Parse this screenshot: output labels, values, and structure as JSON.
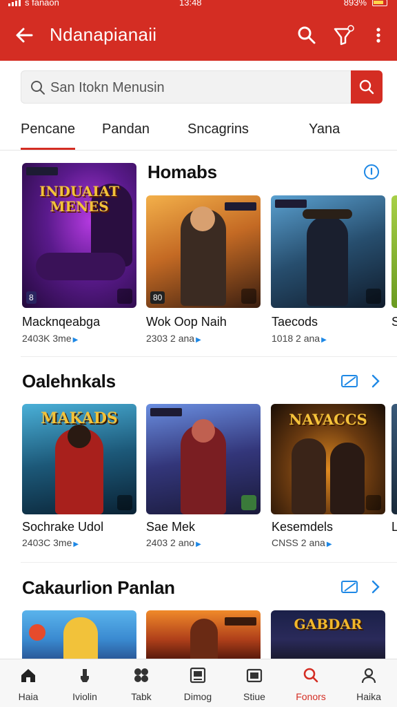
{
  "status_bar": {
    "carrier": "s fanaon",
    "time": "13:48",
    "battery": "893%"
  },
  "app_bar": {
    "title": "Ndanapianaii",
    "icons": [
      "back-arrow-icon",
      "search-icon",
      "filter-icon",
      "more-vert-icon"
    ]
  },
  "search": {
    "placeholder": "San Itokn Menusin"
  },
  "tabs": [
    {
      "label": "Pencane",
      "active": true
    },
    {
      "label": "Pandan"
    },
    {
      "label": "Sncagrins"
    },
    {
      "label": "Yana"
    }
  ],
  "sections": [
    {
      "title": "Homabs",
      "cards": [
        {
          "title": "Macknqeabga",
          "meta": "2403K 3me",
          "art_text": "INDUAIAT MENES",
          "badge": "8",
          "colors": [
            "#3a0f5e",
            "#a12fd6"
          ]
        },
        {
          "title": "Wok Oop Naih",
          "meta": "2303 2 ana",
          "badge": "80",
          "colors": [
            "#4a2a12",
            "#e08a2c"
          ]
        },
        {
          "title": "Taecods",
          "meta": "1018 2 ana",
          "colors": [
            "#12223a",
            "#3a7fa8"
          ]
        },
        {
          "title": "S",
          "meta": ""
        }
      ]
    },
    {
      "title": "Oalehnkals",
      "cards": [
        {
          "title": "Sochrake Udol",
          "meta": "2403C 3me",
          "art_text": "MAKADS",
          "colors": [
            "#0e3c5c",
            "#3aa4c8"
          ]
        },
        {
          "title": "Sae Mek",
          "meta": "2403 2 ano",
          "colors": [
            "#2b2a6a",
            "#4d7cc2"
          ]
        },
        {
          "title": "Kesemdels",
          "meta": "CNSS 2 ana",
          "art_text": "NAVACCS",
          "colors": [
            "#2b1a0c",
            "#d08a1e"
          ]
        },
        {
          "title": "L",
          "meta": ""
        }
      ]
    },
    {
      "title": "Cakaurlion Panlan",
      "cards": [
        {
          "colors": [
            "#3da0e0",
            "#e64b2c"
          ]
        },
        {
          "colors": [
            "#6a1a10",
            "#f07a20"
          ]
        },
        {
          "art_text": "GABDAR",
          "colors": [
            "#161a3c",
            "#d8a020"
          ]
        }
      ]
    }
  ],
  "bottom_nav": [
    {
      "label": "Haia",
      "icon": "home-icon"
    },
    {
      "label": "Iviolin",
      "icon": "thumb-icon"
    },
    {
      "label": "Tabk",
      "icon": "grid-icon"
    },
    {
      "label": "Dimog",
      "icon": "tablet-icon"
    },
    {
      "label": "Stiue",
      "icon": "gallery-icon"
    },
    {
      "label": "Fonors",
      "icon": "search-icon",
      "active": true
    },
    {
      "label": "Haika",
      "icon": "profile-icon"
    }
  ],
  "colors": {
    "primary": "#d42d23",
    "link_blue": "#1e88e5"
  }
}
